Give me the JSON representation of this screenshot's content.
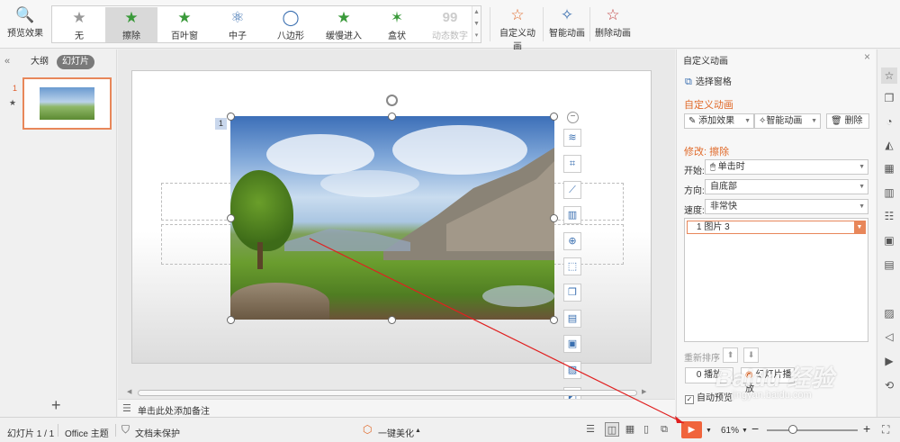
{
  "ribbon": {
    "preview_label": "预览效果",
    "effects": [
      {
        "label": "无",
        "icon": "star-icon"
      },
      {
        "label": "擦除",
        "icon": "star-wipe-icon"
      },
      {
        "label": "百叶窗",
        "icon": "star-blinds-icon"
      },
      {
        "label": "中子",
        "icon": "atom-icon"
      },
      {
        "label": "八边形",
        "icon": "octagon-icon"
      },
      {
        "label": "缓慢进入",
        "icon": "star-slow-icon"
      },
      {
        "label": "盒状",
        "icon": "star-box-icon"
      },
      {
        "label": "动态数字",
        "icon": "digits-icon",
        "glyph": "99"
      }
    ],
    "selected_effect": "擦除",
    "custom_anim_label": "自定义动画",
    "smart_anim_label": "智能动画",
    "delete_anim_label": "删除动画"
  },
  "left_panel": {
    "tab_outline": "大纲",
    "tab_slides": "幻灯片",
    "slide_number": "1"
  },
  "canvas": {
    "anim_order_tag": "1",
    "notes_placeholder": "单击此处添加备注"
  },
  "task_pane": {
    "title": "自定义动画",
    "select_pane": "选择窗格",
    "section_custom": "自定义动画",
    "add_effect": "添加效果",
    "smart_anim": "智能动画",
    "delete": "删除",
    "modify_heading": "修改: 擦除",
    "start_label": "开始:",
    "start_value": "单击时",
    "direction_label": "方向:",
    "direction_value": "自底部",
    "speed_label": "速度:",
    "speed_value": "非常快",
    "list_item": "1  图片 3",
    "reorder_label": "重新排序",
    "play_button": "0 播放",
    "show_button": "幻灯片播放",
    "autopreview_label": "自动预览"
  },
  "status_bar": {
    "slide_count": "幻灯片 1 / 1",
    "theme": "Office 主题",
    "protect": "文档未保护",
    "beautify": "一键美化",
    "zoom": "61%"
  },
  "watermark": {
    "brand": "Baidu 经验",
    "url": "jingyan.baidu.com"
  },
  "colors": {
    "accent": "#e06a2a",
    "play_button": "#f0643c",
    "selection": "#e8875a"
  }
}
